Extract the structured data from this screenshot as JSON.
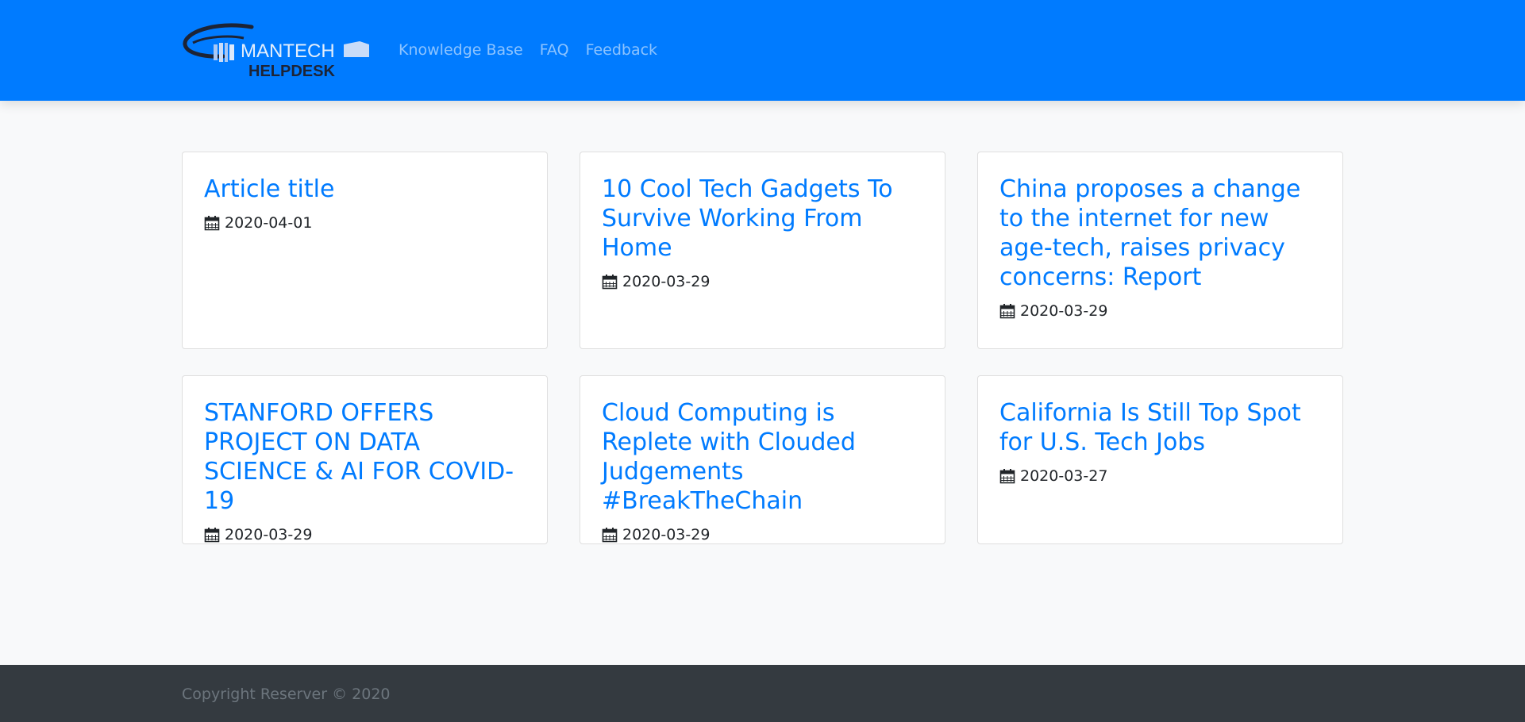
{
  "header": {
    "brand": {
      "line1": "MANTECH",
      "line2": "HELPDESK"
    },
    "nav": [
      {
        "label": "Knowledge Base"
      },
      {
        "label": "FAQ"
      },
      {
        "label": "Feedback"
      }
    ]
  },
  "articles": [
    {
      "title": "Article title",
      "date": "2020-04-01"
    },
    {
      "title": "10 Cool Tech Gadgets To Survive Working From Home",
      "date": "2020-03-29"
    },
    {
      "title": "China proposes a change to the internet for new age-tech, raises privacy concerns: Report",
      "date": "2020-03-29"
    },
    {
      "title": "STANFORD OFFERS PROJECT ON DATA SCIENCE & AI FOR COVID-19",
      "date": "2020-03-29"
    },
    {
      "title": "Cloud Computing is Replete with Clouded Judgements #BreakTheChain",
      "date": "2020-03-29"
    },
    {
      "title": "California Is Still Top Spot for U.S. Tech Jobs",
      "date": "2020-03-27"
    }
  ],
  "footer": {
    "copyright": "Copyright Reserver © 2020"
  },
  "colors": {
    "primary": "#007bff",
    "footer_bg": "#343a40",
    "page_bg": "#f8f9fa"
  }
}
